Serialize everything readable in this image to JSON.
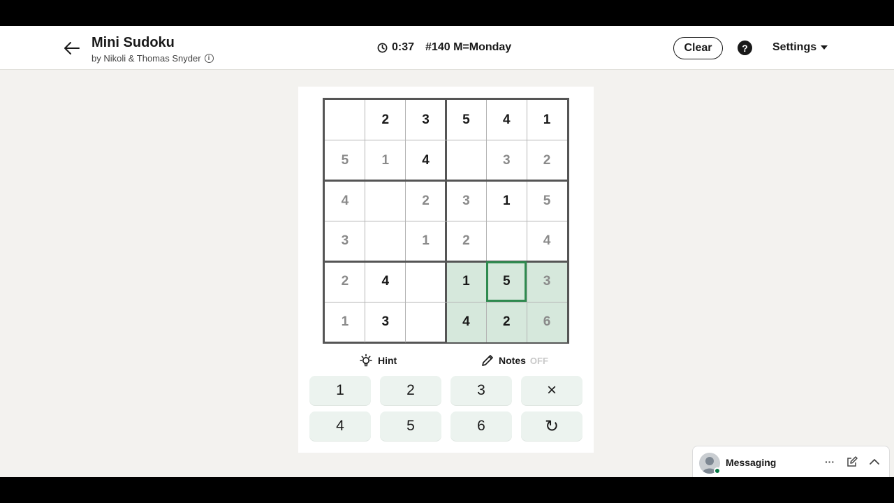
{
  "header": {
    "title": "Mini Sudoku",
    "byline": "by Nikoli & Thomas Snyder",
    "timer": "0:37",
    "puzzle_label": "#140 M=Monday",
    "clear_label": "Clear",
    "help_glyph": "?",
    "settings_label": "Settings"
  },
  "board": {
    "cells": [
      [
        "",
        "2",
        "3",
        "5",
        "4",
        "1"
      ],
      [
        "5",
        "1",
        "4",
        "",
        "3",
        "2"
      ],
      [
        "4",
        "",
        "2",
        "3",
        "1",
        "5"
      ],
      [
        "3",
        "",
        "1",
        "2",
        "",
        "4"
      ],
      [
        "2",
        "4",
        "",
        "1",
        "5",
        "3"
      ],
      [
        "1",
        "3",
        "",
        "4",
        "2",
        "6"
      ]
    ],
    "given": [
      [
        0,
        1,
        1,
        1,
        1,
        1
      ],
      [
        0,
        0,
        1,
        0,
        0,
        0
      ],
      [
        0,
        0,
        0,
        0,
        1,
        0
      ],
      [
        0,
        0,
        0,
        0,
        0,
        0
      ],
      [
        0,
        1,
        0,
        1,
        1,
        0
      ],
      [
        0,
        1,
        0,
        1,
        1,
        0
      ]
    ],
    "selected": [
      4,
      4
    ],
    "highlighted_region": {
      "rows": [
        4,
        5
      ],
      "cols": [
        3,
        4,
        5
      ]
    }
  },
  "tools": {
    "hint_label": "Hint",
    "notes_label": "Notes",
    "notes_state": "OFF"
  },
  "keypad": {
    "keys": [
      "1",
      "2",
      "3",
      "×",
      "4",
      "5",
      "6",
      "↻"
    ]
  },
  "messaging": {
    "label": "Messaging",
    "more_glyph": "···"
  },
  "colors": {
    "selected_border": "#2f8a4f",
    "region_highlight": "#d6e8dc",
    "key_background": "#ecf3ef"
  }
}
